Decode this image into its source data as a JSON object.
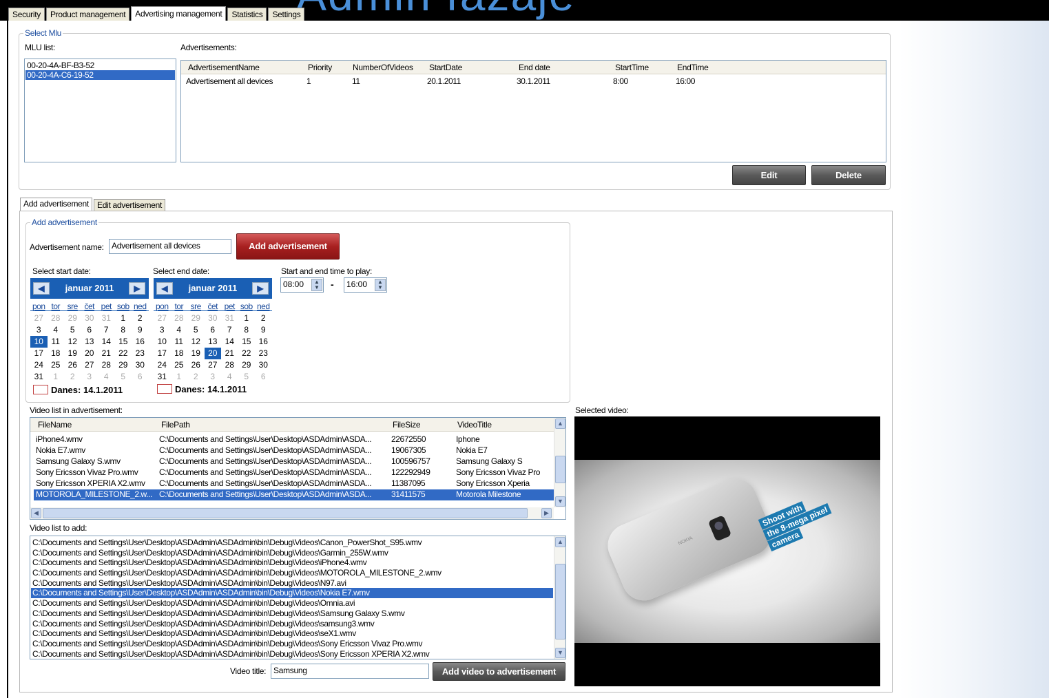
{
  "background_title": "Admin fazaje",
  "main_tabs": [
    "Security",
    "Product management",
    "Advertising management",
    "Statistics",
    "Settings"
  ],
  "select_mlu": {
    "group_title": "Select Mlu",
    "mlu_list_label": "MLU list:",
    "mlu_list": [
      "00-20-4A-BF-B3-52",
      "00-20-4A-C6-19-52"
    ],
    "ads_label": "Advertisements:",
    "ads_columns": [
      "AdvertisementName",
      "Priority",
      "NumberOfVideos",
      "StartDate",
      "End date",
      "StartTime",
      "EndTime"
    ],
    "ads_rows": [
      [
        "Advertisement all devices",
        "1",
        "11",
        "20.1.2011",
        "30.1.2011",
        "8:00",
        "16:00"
      ]
    ],
    "edit_button": "Edit",
    "delete_button": "Delete"
  },
  "sub_tabs": [
    "Add advertisement",
    "Edit advertisement"
  ],
  "add_ad": {
    "group_title": "Add advertisement",
    "name_label": "Advertisement name:",
    "name_value": "Advertisement all devices",
    "add_button": "Add advertisement",
    "start_date_label": "Select start date:",
    "end_date_label": "Select end date:",
    "time_label": "Start and end time to play:",
    "start_time": "08:00",
    "time_dash": "-",
    "end_time": "16:00"
  },
  "calendar": {
    "month": "januar 2011",
    "day_names": [
      "pon",
      "tor",
      "sre",
      "čet",
      "pet",
      "sob",
      "ned"
    ],
    "weeks": [
      [
        "27",
        "28",
        "29",
        "30",
        "31",
        "1",
        "2"
      ],
      [
        "3",
        "4",
        "5",
        "6",
        "7",
        "8",
        "9"
      ],
      [
        "10",
        "11",
        "12",
        "13",
        "14",
        "15",
        "16"
      ],
      [
        "17",
        "18",
        "19",
        "20",
        "21",
        "22",
        "23"
      ],
      [
        "24",
        "25",
        "26",
        "27",
        "28",
        "29",
        "30"
      ],
      [
        "31",
        "1",
        "2",
        "3",
        "4",
        "5",
        "6"
      ]
    ],
    "today_text": "Danes: 14.1.2011",
    "start_selected_day": "10",
    "end_selected_day": "20"
  },
  "video_list": {
    "label": "Video list in advertisement:",
    "columns": [
      "FileName",
      "FilePath",
      "FileSize",
      "VideoTitle"
    ],
    "rows": [
      [
        "iPhone4.wmv",
        "C:\\Documents and Settings\\User\\Desktop\\ASDAdmin\\ASDA...",
        "22672550",
        "Iphone"
      ],
      [
        "Nokia E7.wmv",
        "C:\\Documents and Settings\\User\\Desktop\\ASDAdmin\\ASDA...",
        "19067305",
        "Nokia E7"
      ],
      [
        "Samsung Galaxy S.wmv",
        "C:\\Documents and Settings\\User\\Desktop\\ASDAdmin\\ASDA...",
        "100596757",
        "Samsung Galaxy S"
      ],
      [
        "Sony Ericsson Vivaz Pro.wmv",
        "C:\\Documents and Settings\\User\\Desktop\\ASDAdmin\\ASDA...",
        "122292949",
        "Sony Ericsson Vivaz Pro"
      ],
      [
        "Sony Ericsson XPERIA X2.wmv",
        "C:\\Documents and Settings\\User\\Desktop\\ASDAdmin\\ASDA...",
        "11387095",
        "Sony Ericsson Xperia"
      ],
      [
        "MOTOROLA_MILESTONE_2.w...",
        "C:\\Documents and Settings\\User\\Desktop\\ASDAdmin\\ASDA...",
        "31411575",
        "Motorola Milestone"
      ]
    ]
  },
  "video_add": {
    "label": "Video list to add:",
    "items": [
      "C:\\Documents and Settings\\User\\Desktop\\ASDAdmin\\ASDAdmin\\bin\\Debug\\Videos\\Canon_PowerShot_S95.wmv",
      "C:\\Documents and Settings\\User\\Desktop\\ASDAdmin\\ASDAdmin\\bin\\Debug\\Videos\\Garmin_255W.wmv",
      "C:\\Documents and Settings\\User\\Desktop\\ASDAdmin\\ASDAdmin\\bin\\Debug\\Videos\\iPhone4.wmv",
      "C:\\Documents and Settings\\User\\Desktop\\ASDAdmin\\ASDAdmin\\bin\\Debug\\Videos\\MOTOROLA_MILESTONE_2.wmv",
      "C:\\Documents and Settings\\User\\Desktop\\ASDAdmin\\ASDAdmin\\bin\\Debug\\Videos\\N97.avi",
      "C:\\Documents and Settings\\User\\Desktop\\ASDAdmin\\ASDAdmin\\bin\\Debug\\Videos\\Nokia E7.wmv",
      "C:\\Documents and Settings\\User\\Desktop\\ASDAdmin\\ASDAdmin\\bin\\Debug\\Videos\\Omnia.avi",
      "C:\\Documents and Settings\\User\\Desktop\\ASDAdmin\\ASDAdmin\\bin\\Debug\\Videos\\Samsung Galaxy S.wmv",
      "C:\\Documents and Settings\\User\\Desktop\\ASDAdmin\\ASDAdmin\\bin\\Debug\\Videos\\samsung3.wmv",
      "C:\\Documents and Settings\\User\\Desktop\\ASDAdmin\\ASDAdmin\\bin\\Debug\\Videos\\seX1.wmv",
      "C:\\Documents and Settings\\User\\Desktop\\ASDAdmin\\ASDAdmin\\bin\\Debug\\Videos\\Sony Ericsson Vivaz Pro.wmv",
      "C:\\Documents and Settings\\User\\Desktop\\ASDAdmin\\ASDAdmin\\bin\\Debug\\Videos\\Sony Ericsson XPERIA X2.wmv"
    ],
    "selected_index": 5,
    "title_label": "Video title:",
    "title_value": "Samsung",
    "add_button": "Add video to advertisement"
  },
  "selected_video": {
    "label": "Selected video:",
    "promo_lines": [
      "Shoot with",
      "the 8-mega pixel",
      "camera"
    ],
    "phone_brand": "NOKIA"
  },
  "colors": {
    "selection": "#316ac5",
    "calendar_header": "#1a5fb4",
    "group_title": "#2050a0",
    "add_button_red": "#a82020",
    "promo_blue": "#1d7ab0"
  }
}
